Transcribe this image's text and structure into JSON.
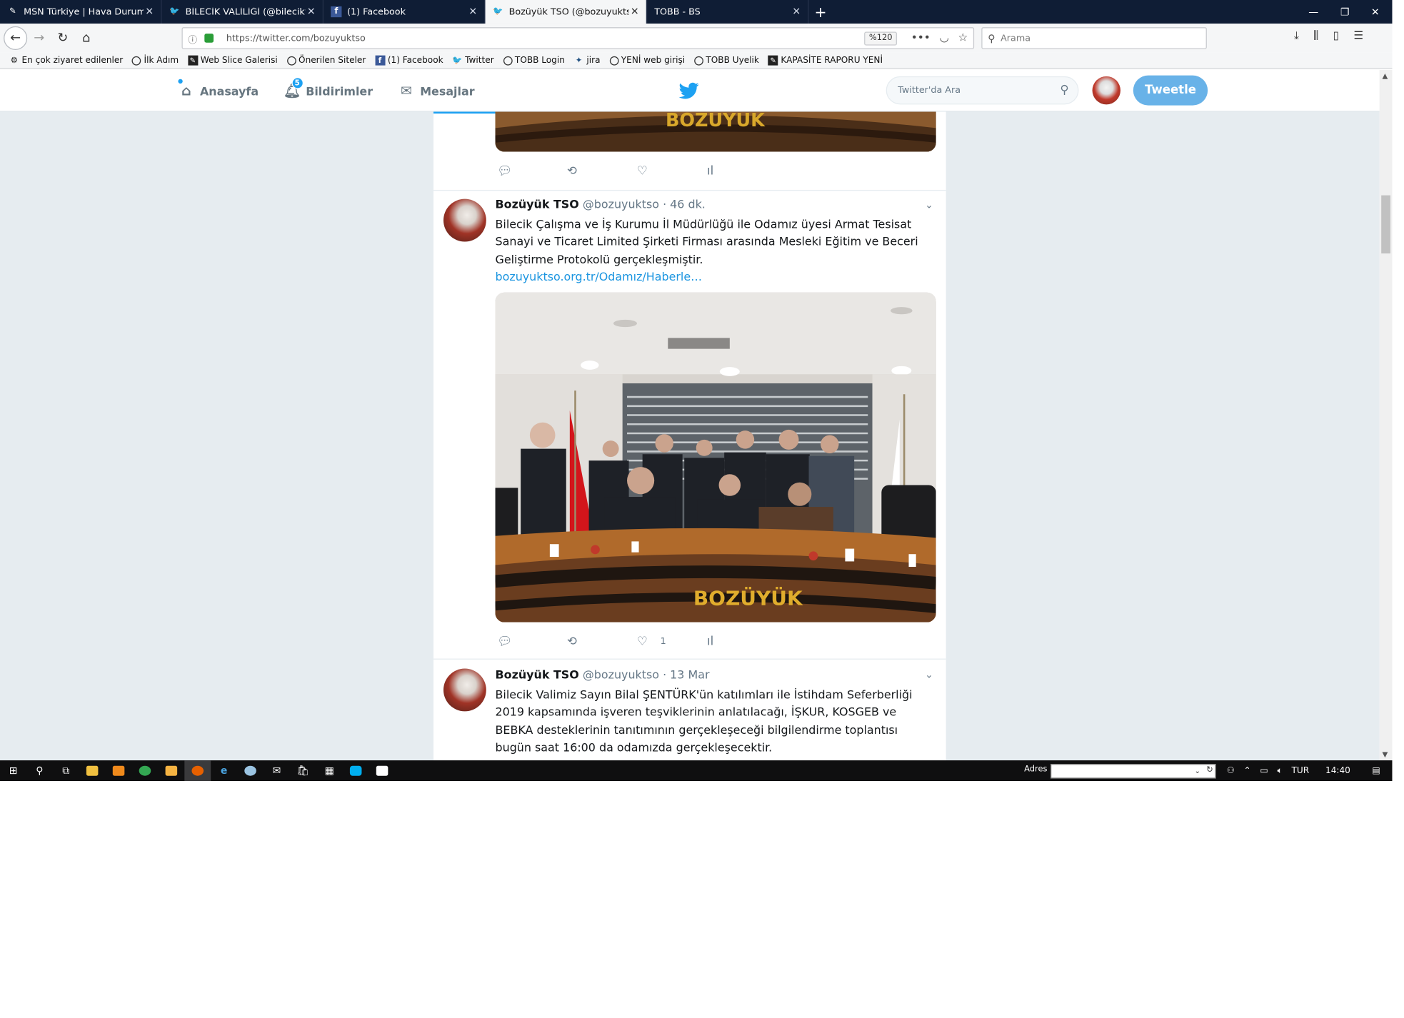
{
  "browser": {
    "tabs": [
      {
        "title": "MSN Türkiye | Hava Durumu, S",
        "icon": "msn-icon",
        "active": false
      },
      {
        "title": "BİLECİK VALİLİĞİ (@bilecikvalili",
        "icon": "twitter-icon",
        "active": false
      },
      {
        "title": "(1) Facebook",
        "icon": "facebook-icon",
        "active": false
      },
      {
        "title": "Bozüyük TSO (@bozuyuktso) |",
        "icon": "twitter-icon",
        "active": true
      },
      {
        "title": "TOBB - BS",
        "icon": "",
        "active": false
      }
    ],
    "new_tab": "+",
    "close_glyph": "✕",
    "url": "https://twitter.com/bozuyuktso",
    "zoom": "%120",
    "search_placeholder": "Arama",
    "bookmarks": [
      {
        "label": "En çok ziyaret edilenler",
        "icon": "gear-icon"
      },
      {
        "label": "İlk Adım",
        "icon": "globe-icon"
      },
      {
        "label": "Web Slice Galerisi",
        "icon": "webslice-icon"
      },
      {
        "label": "Önerilen Siteler",
        "icon": "globe-icon"
      },
      {
        "label": "(1) Facebook",
        "icon": "facebook-icon"
      },
      {
        "label": "Twitter",
        "icon": "twitter-icon"
      },
      {
        "label": "TOBB Login",
        "icon": "globe-icon"
      },
      {
        "label": "jira",
        "icon": "jira-icon"
      },
      {
        "label": "YENİ web girişi",
        "icon": "globe-icon"
      },
      {
        "label": "TOBB Uyelik",
        "icon": "globe-icon"
      },
      {
        "label": "KAPASİTE RAPORU YENİ",
        "icon": "webslice-icon"
      }
    ]
  },
  "twitter": {
    "nav": {
      "home": "Anasayfa",
      "notifications": "Bildirimler",
      "notifications_count": "5",
      "messages": "Mesajlar"
    },
    "search_placeholder": "Twitter'da Ara",
    "tweet_button": "Tweetle",
    "brand_color": "#1da1f2",
    "tweets": [
      {
        "name": "Bozüyük TSO",
        "handle": "@bozuyuktso",
        "time": "· 46 dk.",
        "text": "Bilecik Çalışma ve İş Kurumu İl Müdürlüğü ile Odamız üyesi Armat Tesisat Sanayi ve Ticaret Limited Şirketi Firması arasında Mesleki Eğitim ve Beceri Geliştirme Protokolü gerçekleşmiştir.",
        "link": "bozuyuktso.org.tr/Odamız/Haberle…",
        "likes": "1",
        "photo_sign": "BOZÜYÜK"
      },
      {
        "name": "Bozüyük TSO",
        "handle": "@bozuyuktso",
        "time": "· 13 Mar",
        "text": "Bilecik Valimiz Sayın Bilal ŞENTÜRK'ün katılımları ile  İstihdam Seferberliği 2019 kapsamında işveren teşviklerinin anlatılacağı, İŞKUR, KOSGEB ve BEBKA desteklerinin tanıtımının gerçekleşeceği bilgilendirme toplantısı bugün saat 16:00 da odamızda gerçekleşecektir."
      }
    ],
    "previous_photo_sign": "BOZÜYÜK"
  },
  "taskbar": {
    "address_label": "Adres",
    "language": "TUR",
    "time": "14:40"
  }
}
